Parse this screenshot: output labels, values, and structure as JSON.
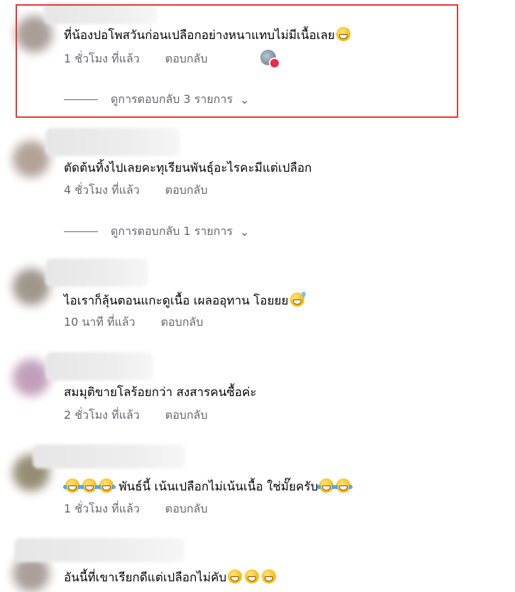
{
  "comments": [
    {
      "text": "ที่น้องปอโพสวันก่อนเปลือกอย่างหนาแทบไม่มีเนื้อเลย",
      "emojis_after": [
        "grinning-squinting-face"
      ],
      "time": "1 ชั่วโมง ที่แล้ว",
      "reply": "ตอบกลับ",
      "view_replies": "ดูการตอบกลับ 3 รายการ",
      "has_reaction": true
    },
    {
      "text": "ตัดต้นทิ้งไปเลยคะทุเรียนพันธุ์อะไรคะมีแต่เปลือก",
      "time": "4 ชั่วโมง ที่แล้ว",
      "reply": "ตอบกลับ",
      "view_replies": "ดูการตอบกลับ 1 รายการ"
    },
    {
      "text": "ไอเราก็ลุ้นตอนแกะดูเนื้อ เผลออุทาน โอยยย",
      "emojis_after": [
        "grinning-face-with-sweat"
      ],
      "time": "10 นาที ที่แล้ว",
      "reply": "ตอบกลับ"
    },
    {
      "text": "สมมุติขายโลร้อยกว่า สงสารคนซื้อค่ะ",
      "time": "2 ชั่วโมง ที่แล้ว",
      "reply": "ตอบกลับ"
    },
    {
      "emojis_before": [
        "face-with-tears-of-joy",
        "face-with-tears-of-joy",
        "face-with-tears-of-joy"
      ],
      "text": "พันธ์นี้ เน้นเปลือกไม่เน้นเนื้อ ใช่มั๊ยครับ",
      "emojis_after": [
        "face-with-tears-of-joy",
        "face-with-tears-of-joy"
      ],
      "time": "1 ชั่วโมง ที่แล้ว",
      "reply": "ตอบกลับ"
    },
    {
      "text": "อันนี้ที่เขาเรียกดีแต่เปลือกไม่คับ",
      "emojis_after": [
        "grinning-squinting-face",
        "grinning-squinting-face",
        "grinning-squinting-face"
      ]
    }
  ],
  "colors": {
    "text": "#050505",
    "secondary": "#65676b",
    "highlight_border": "#e53935",
    "reaction_badge": "#f02849"
  }
}
